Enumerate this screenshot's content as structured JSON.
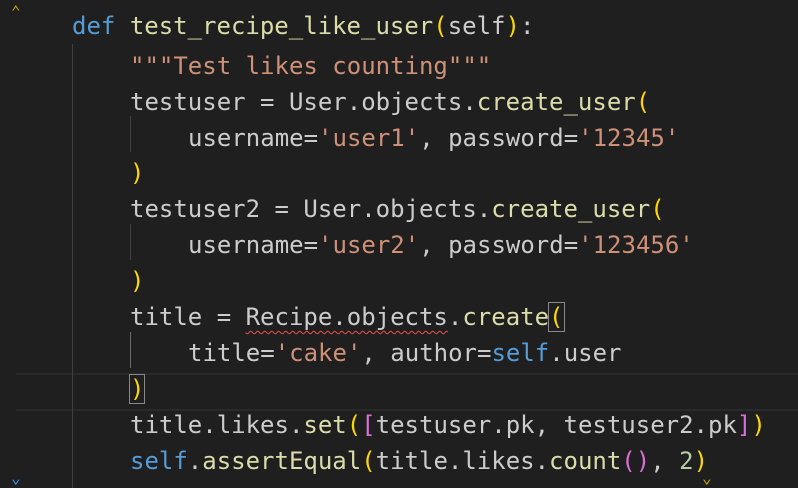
{
  "editor": {
    "lines": [
      {
        "id": "def",
        "tokens": [
          {
            "t": "def",
            "c": "kw"
          },
          {
            "t": " ",
            "c": "pl"
          },
          {
            "t": "test_recipe_like_user",
            "c": "fn"
          },
          {
            "t": "(",
            "c": "p1"
          },
          {
            "t": "self",
            "c": "pl"
          },
          {
            "t": ")",
            "c": "p1"
          },
          {
            "t": ":",
            "c": "pl"
          }
        ]
      },
      {
        "id": "docstring",
        "tokens": [
          {
            "t": "\"\"\"Test likes counting\"\"\"",
            "c": "str"
          }
        ]
      },
      {
        "id": "testuser-assign",
        "tokens": [
          {
            "t": "testuser = User.objects.",
            "c": "pl"
          },
          {
            "t": "create_user",
            "c": "fn"
          },
          {
            "t": "(",
            "c": "p1"
          }
        ]
      },
      {
        "id": "testuser-args",
        "tokens": [
          {
            "t": "username=",
            "c": "pl"
          },
          {
            "t": "'user1'",
            "c": "str"
          },
          {
            "t": ", password=",
            "c": "pl"
          },
          {
            "t": "'12345'",
            "c": "str"
          }
        ]
      },
      {
        "id": "testuser-close",
        "tokens": [
          {
            "t": ")",
            "c": "p1"
          }
        ]
      },
      {
        "id": "testuser2-assign",
        "tokens": [
          {
            "t": "testuser2 = User.objects.",
            "c": "pl"
          },
          {
            "t": "create_user",
            "c": "fn"
          },
          {
            "t": "(",
            "c": "p1"
          }
        ]
      },
      {
        "id": "testuser2-args",
        "tokens": [
          {
            "t": "username=",
            "c": "pl"
          },
          {
            "t": "'user2'",
            "c": "str"
          },
          {
            "t": ", password=",
            "c": "pl"
          },
          {
            "t": "'123456'",
            "c": "str"
          }
        ]
      },
      {
        "id": "testuser2-close",
        "tokens": [
          {
            "t": ")",
            "c": "p1"
          }
        ]
      },
      {
        "id": "title-assign",
        "tokens": [
          {
            "t": "title = ",
            "c": "pl"
          },
          {
            "t": "Recipe.objects",
            "c": "pl",
            "squiggle": true
          },
          {
            "t": ".",
            "c": "pl"
          },
          {
            "t": "create",
            "c": "fn"
          },
          {
            "t": "(",
            "c": "p1",
            "match": true
          }
        ]
      },
      {
        "id": "title-args",
        "tokens": [
          {
            "t": "title=",
            "c": "pl"
          },
          {
            "t": "'cake'",
            "c": "str"
          },
          {
            "t": ", author=",
            "c": "pl"
          },
          {
            "t": "self",
            "c": "kw"
          },
          {
            "t": ".user",
            "c": "pl"
          }
        ]
      },
      {
        "id": "title-close",
        "tokens": [
          {
            "t": ")",
            "c": "p1",
            "match": true
          }
        ]
      },
      {
        "id": "likes-set",
        "tokens": [
          {
            "t": "title.likes.",
            "c": "pl"
          },
          {
            "t": "set",
            "c": "fn"
          },
          {
            "t": "(",
            "c": "p1"
          },
          {
            "t": "[",
            "c": "p2"
          },
          {
            "t": "testuser.pk, testuser2.pk",
            "c": "pl"
          },
          {
            "t": "]",
            "c": "p2"
          },
          {
            "t": ")",
            "c": "p1"
          }
        ]
      },
      {
        "id": "assert",
        "tokens": [
          {
            "t": "self",
            "c": "kw"
          },
          {
            "t": ".",
            "c": "pl"
          },
          {
            "t": "assertEqual",
            "c": "fn"
          },
          {
            "t": "(",
            "c": "p1"
          },
          {
            "t": "title.likes.",
            "c": "pl"
          },
          {
            "t": "count",
            "c": "fn"
          },
          {
            "t": "()",
            "c": "p2"
          },
          {
            "t": ", ",
            "c": "pl"
          },
          {
            "t": "2",
            "c": "num"
          },
          {
            "t": ")",
            "c": "p1"
          }
        ]
      }
    ]
  },
  "icons": {
    "fold_top": "fold-indicator-icon",
    "fold_bottom_left": "fold-indicator-icon",
    "fold_bottom_right": "fold-indicator-icon"
  }
}
